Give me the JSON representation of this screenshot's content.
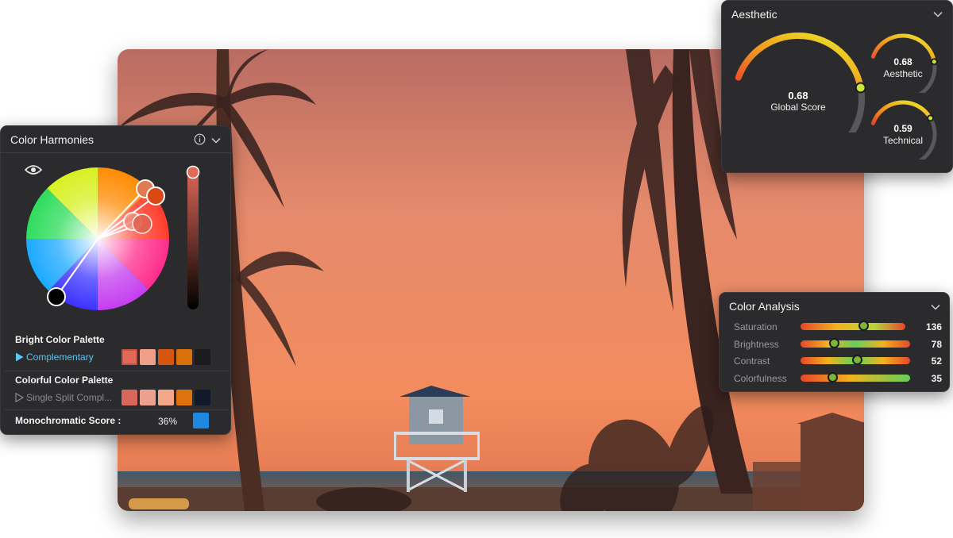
{
  "colors": {
    "accent_link": "#5bc6f5",
    "panel_bg": "#2b2b2d",
    "mono_swatch": "#1e88e0"
  },
  "harmonies": {
    "title": "Color Harmonies",
    "bright_palette": {
      "label": "Bright Color Palette",
      "mode": "Complementary",
      "swatches": [
        "#e0695a",
        "#ef9f88",
        "#d7560f",
        "#d9700a",
        "#1b1b1e"
      ]
    },
    "colorful_palette": {
      "label": "Colorful Color Palette",
      "mode": "Single Split Compl...",
      "swatches": [
        "#d9665a",
        "#eea08f",
        "#f3a78a",
        "#dd730d",
        "#101a2a"
      ]
    },
    "monochromatic": {
      "label": "Monochromatic Score :",
      "value": "36%"
    }
  },
  "aesthetic": {
    "title": "Aesthetic",
    "global": {
      "value": "0.68",
      "label": "Global Score",
      "fraction": 0.68
    },
    "aesthetic_score": {
      "value": "0.68",
      "label": "Aesthetic",
      "fraction": 0.68
    },
    "technical": {
      "value": "0.59",
      "label": "Technical",
      "fraction": 0.59
    }
  },
  "color_analysis": {
    "title": "Color Analysis",
    "rows": [
      {
        "label": "Saturation",
        "value": "136",
        "level": 0.6
      },
      {
        "label": "Brightness",
        "value": "78",
        "level": 0.31
      },
      {
        "label": "Contrast",
        "value": "52",
        "level": 0.52
      },
      {
        "label": "Colorfulness",
        "value": "35",
        "level": 0.29
      }
    ]
  }
}
